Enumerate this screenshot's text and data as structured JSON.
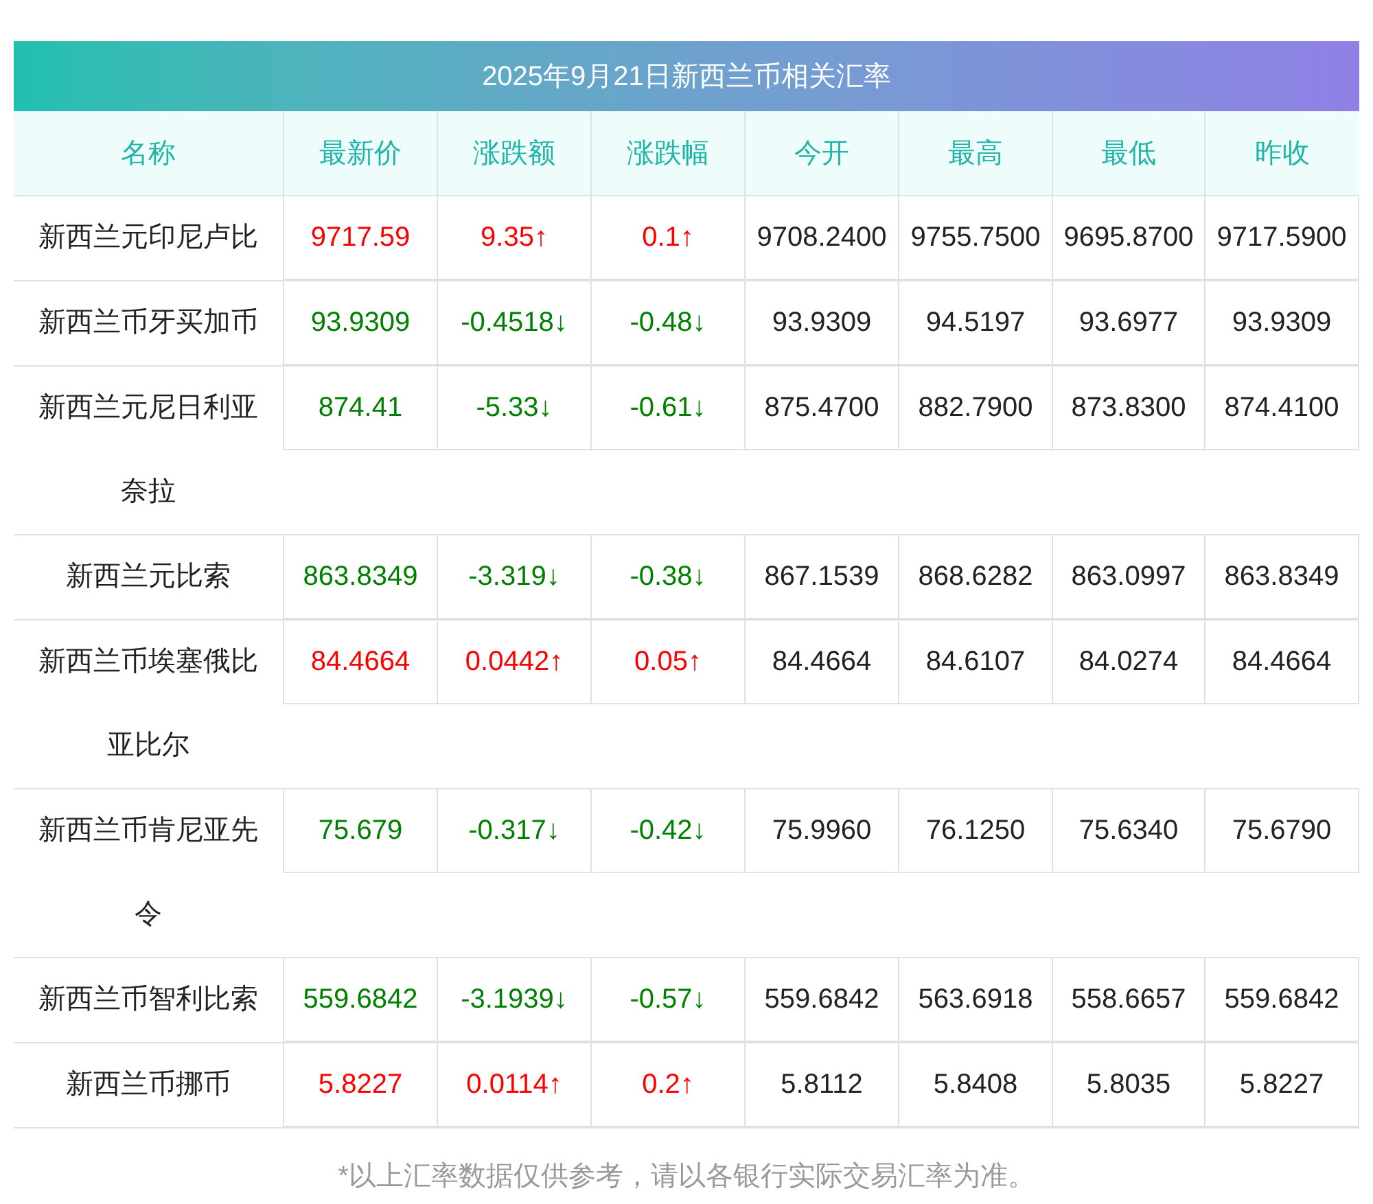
{
  "title": "2025年9月21日新西兰币相关汇率",
  "columns": [
    "名称",
    "最新价",
    "涨跌额",
    "涨跌幅",
    "今开",
    "最高",
    "最低",
    "昨收"
  ],
  "rows": [
    {
      "name": "新西兰元印尼卢比",
      "rising": true,
      "latest": "9717.59",
      "change": "9.35↑",
      "pct": "0.1↑",
      "open": "9708.2400",
      "high": "9755.7500",
      "low": "9695.8700",
      "prev": "9717.5900"
    },
    {
      "name": "新西兰币牙买加币",
      "rising": false,
      "latest": "93.9309",
      "change": "-0.4518↓",
      "pct": "-0.48↓",
      "open": "93.9309",
      "high": "94.5197",
      "low": "93.6977",
      "prev": "93.9309"
    },
    {
      "name": "新西兰元尼日利亚奈拉",
      "rising": false,
      "latest": "874.41",
      "change": "-5.33↓",
      "pct": "-0.61↓",
      "open": "875.4700",
      "high": "882.7900",
      "low": "873.8300",
      "prev": "874.4100"
    },
    {
      "name": "新西兰元比索",
      "rising": false,
      "latest": "863.8349",
      "change": "-3.319↓",
      "pct": "-0.38↓",
      "open": "867.1539",
      "high": "868.6282",
      "low": "863.0997",
      "prev": "863.8349"
    },
    {
      "name": "新西兰币埃塞俄比亚比尔",
      "rising": true,
      "latest": "84.4664",
      "change": "0.0442↑",
      "pct": "0.05↑",
      "open": "84.4664",
      "high": "84.6107",
      "low": "84.0274",
      "prev": "84.4664"
    },
    {
      "name": "新西兰币肯尼亚先令",
      "rising": false,
      "latest": "75.679",
      "change": "-0.317↓",
      "pct": "-0.42↓",
      "open": "75.9960",
      "high": "76.1250",
      "low": "75.6340",
      "prev": "75.6790"
    },
    {
      "name": "新西兰币智利比索",
      "rising": false,
      "latest": "559.6842",
      "change": "-3.1939↓",
      "pct": "-0.57↓",
      "open": "559.6842",
      "high": "563.6918",
      "low": "558.6657",
      "prev": "559.6842"
    },
    {
      "name": "新西兰币挪币",
      "rising": true,
      "latest": "5.8227",
      "change": "0.0114↑",
      "pct": "0.2↑",
      "open": "5.8112",
      "high": "5.8408",
      "low": "5.8035",
      "prev": "5.8227"
    }
  ],
  "footnote": "*以上汇率数据仅供参考，请以各银行实际交易汇率为准。"
}
